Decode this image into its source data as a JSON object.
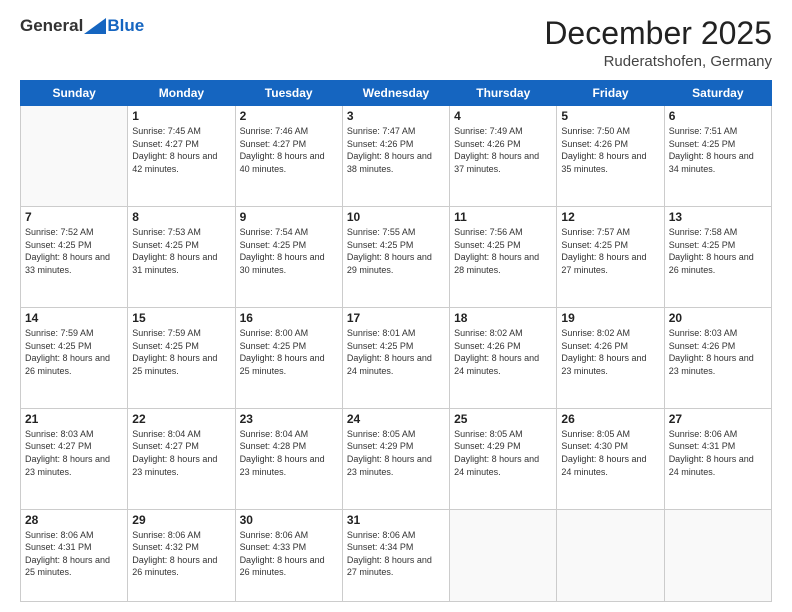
{
  "header": {
    "logo": {
      "general": "General",
      "blue": "Blue"
    },
    "month": "December 2025",
    "location": "Ruderatshofen, Germany"
  },
  "weekdays": [
    "Sunday",
    "Monday",
    "Tuesday",
    "Wednesday",
    "Thursday",
    "Friday",
    "Saturday"
  ],
  "weeks": [
    [
      {
        "day": "",
        "sunrise": "",
        "sunset": "",
        "daylight": ""
      },
      {
        "day": "1",
        "sunrise": "Sunrise: 7:45 AM",
        "sunset": "Sunset: 4:27 PM",
        "daylight": "Daylight: 8 hours and 42 minutes."
      },
      {
        "day": "2",
        "sunrise": "Sunrise: 7:46 AM",
        "sunset": "Sunset: 4:27 PM",
        "daylight": "Daylight: 8 hours and 40 minutes."
      },
      {
        "day": "3",
        "sunrise": "Sunrise: 7:47 AM",
        "sunset": "Sunset: 4:26 PM",
        "daylight": "Daylight: 8 hours and 38 minutes."
      },
      {
        "day": "4",
        "sunrise": "Sunrise: 7:49 AM",
        "sunset": "Sunset: 4:26 PM",
        "daylight": "Daylight: 8 hours and 37 minutes."
      },
      {
        "day": "5",
        "sunrise": "Sunrise: 7:50 AM",
        "sunset": "Sunset: 4:26 PM",
        "daylight": "Daylight: 8 hours and 35 minutes."
      },
      {
        "day": "6",
        "sunrise": "Sunrise: 7:51 AM",
        "sunset": "Sunset: 4:25 PM",
        "daylight": "Daylight: 8 hours and 34 minutes."
      }
    ],
    [
      {
        "day": "7",
        "sunrise": "Sunrise: 7:52 AM",
        "sunset": "Sunset: 4:25 PM",
        "daylight": "Daylight: 8 hours and 33 minutes."
      },
      {
        "day": "8",
        "sunrise": "Sunrise: 7:53 AM",
        "sunset": "Sunset: 4:25 PM",
        "daylight": "Daylight: 8 hours and 31 minutes."
      },
      {
        "day": "9",
        "sunrise": "Sunrise: 7:54 AM",
        "sunset": "Sunset: 4:25 PM",
        "daylight": "Daylight: 8 hours and 30 minutes."
      },
      {
        "day": "10",
        "sunrise": "Sunrise: 7:55 AM",
        "sunset": "Sunset: 4:25 PM",
        "daylight": "Daylight: 8 hours and 29 minutes."
      },
      {
        "day": "11",
        "sunrise": "Sunrise: 7:56 AM",
        "sunset": "Sunset: 4:25 PM",
        "daylight": "Daylight: 8 hours and 28 minutes."
      },
      {
        "day": "12",
        "sunrise": "Sunrise: 7:57 AM",
        "sunset": "Sunset: 4:25 PM",
        "daylight": "Daylight: 8 hours and 27 minutes."
      },
      {
        "day": "13",
        "sunrise": "Sunrise: 7:58 AM",
        "sunset": "Sunset: 4:25 PM",
        "daylight": "Daylight: 8 hours and 26 minutes."
      }
    ],
    [
      {
        "day": "14",
        "sunrise": "Sunrise: 7:59 AM",
        "sunset": "Sunset: 4:25 PM",
        "daylight": "Daylight: 8 hours and 26 minutes."
      },
      {
        "day": "15",
        "sunrise": "Sunrise: 7:59 AM",
        "sunset": "Sunset: 4:25 PM",
        "daylight": "Daylight: 8 hours and 25 minutes."
      },
      {
        "day": "16",
        "sunrise": "Sunrise: 8:00 AM",
        "sunset": "Sunset: 4:25 PM",
        "daylight": "Daylight: 8 hours and 25 minutes."
      },
      {
        "day": "17",
        "sunrise": "Sunrise: 8:01 AM",
        "sunset": "Sunset: 4:25 PM",
        "daylight": "Daylight: 8 hours and 24 minutes."
      },
      {
        "day": "18",
        "sunrise": "Sunrise: 8:02 AM",
        "sunset": "Sunset: 4:26 PM",
        "daylight": "Daylight: 8 hours and 24 minutes."
      },
      {
        "day": "19",
        "sunrise": "Sunrise: 8:02 AM",
        "sunset": "Sunset: 4:26 PM",
        "daylight": "Daylight: 8 hours and 23 minutes."
      },
      {
        "day": "20",
        "sunrise": "Sunrise: 8:03 AM",
        "sunset": "Sunset: 4:26 PM",
        "daylight": "Daylight: 8 hours and 23 minutes."
      }
    ],
    [
      {
        "day": "21",
        "sunrise": "Sunrise: 8:03 AM",
        "sunset": "Sunset: 4:27 PM",
        "daylight": "Daylight: 8 hours and 23 minutes."
      },
      {
        "day": "22",
        "sunrise": "Sunrise: 8:04 AM",
        "sunset": "Sunset: 4:27 PM",
        "daylight": "Daylight: 8 hours and 23 minutes."
      },
      {
        "day": "23",
        "sunrise": "Sunrise: 8:04 AM",
        "sunset": "Sunset: 4:28 PM",
        "daylight": "Daylight: 8 hours and 23 minutes."
      },
      {
        "day": "24",
        "sunrise": "Sunrise: 8:05 AM",
        "sunset": "Sunset: 4:29 PM",
        "daylight": "Daylight: 8 hours and 23 minutes."
      },
      {
        "day": "25",
        "sunrise": "Sunrise: 8:05 AM",
        "sunset": "Sunset: 4:29 PM",
        "daylight": "Daylight: 8 hours and 24 minutes."
      },
      {
        "day": "26",
        "sunrise": "Sunrise: 8:05 AM",
        "sunset": "Sunset: 4:30 PM",
        "daylight": "Daylight: 8 hours and 24 minutes."
      },
      {
        "day": "27",
        "sunrise": "Sunrise: 8:06 AM",
        "sunset": "Sunset: 4:31 PM",
        "daylight": "Daylight: 8 hours and 24 minutes."
      }
    ],
    [
      {
        "day": "28",
        "sunrise": "Sunrise: 8:06 AM",
        "sunset": "Sunset: 4:31 PM",
        "daylight": "Daylight: 8 hours and 25 minutes."
      },
      {
        "day": "29",
        "sunrise": "Sunrise: 8:06 AM",
        "sunset": "Sunset: 4:32 PM",
        "daylight": "Daylight: 8 hours and 26 minutes."
      },
      {
        "day": "30",
        "sunrise": "Sunrise: 8:06 AM",
        "sunset": "Sunset: 4:33 PM",
        "daylight": "Daylight: 8 hours and 26 minutes."
      },
      {
        "day": "31",
        "sunrise": "Sunrise: 8:06 AM",
        "sunset": "Sunset: 4:34 PM",
        "daylight": "Daylight: 8 hours and 27 minutes."
      },
      {
        "day": "",
        "sunrise": "",
        "sunset": "",
        "daylight": ""
      },
      {
        "day": "",
        "sunrise": "",
        "sunset": "",
        "daylight": ""
      },
      {
        "day": "",
        "sunrise": "",
        "sunset": "",
        "daylight": ""
      }
    ]
  ]
}
